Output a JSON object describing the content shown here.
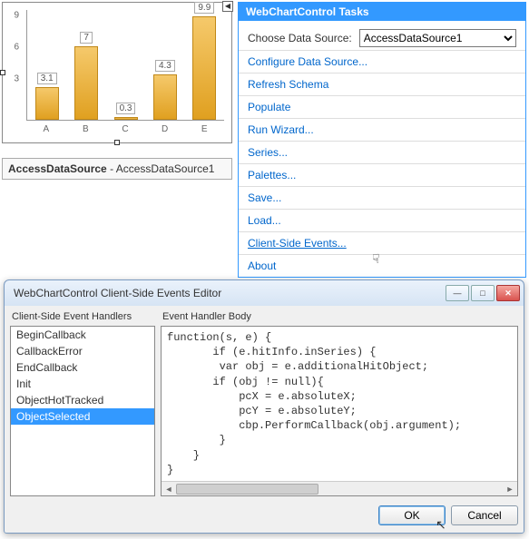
{
  "chart_data": {
    "type": "bar",
    "categories": [
      "A",
      "B",
      "C",
      "D",
      "E"
    ],
    "values": [
      3.1,
      7,
      0.3,
      4.3,
      9.9
    ],
    "y_ticks": [
      3,
      6,
      9
    ],
    "ylim": [
      0,
      10.5
    ],
    "bar_color": "#e8aa2e"
  },
  "chart": {
    "smart_tag_glyph": "◀"
  },
  "datasource": {
    "type": "AccessDataSource",
    "name": "AccessDataSource1"
  },
  "tasks": {
    "title": "WebChartControl Tasks",
    "choose_label": "Choose Data Source:",
    "choose_value": "AccessDataSource1",
    "links": [
      "Configure Data Source...",
      "Refresh Schema",
      "Populate",
      "Run Wizard...",
      "Series...",
      "Palettes...",
      "Save...",
      "Load...",
      "Client-Side Events...",
      "About"
    ],
    "hover_index": 8
  },
  "dialog": {
    "title": "WebChartControl Client-Side Events Editor",
    "left_label": "Client-Side Event Handlers",
    "right_label": "Event Handler Body",
    "events": [
      "BeginCallback",
      "CallbackError",
      "EndCallback",
      "Init",
      "ObjectHotTracked",
      "ObjectSelected"
    ],
    "selected_index": 5,
    "code": "function(s, e) {\n       if (e.hitInfo.inSeries) {\n        var obj = e.additionalHitObject;\n       if (obj != null){\n           pcX = e.absoluteX;\n           pcY = e.absoluteY;\n           cbp.PerformCallback(obj.argument);\n        }\n    }\n}",
    "ok": "OK",
    "cancel": "Cancel",
    "win": {
      "min": "—",
      "max": "□",
      "close": "✕"
    }
  }
}
